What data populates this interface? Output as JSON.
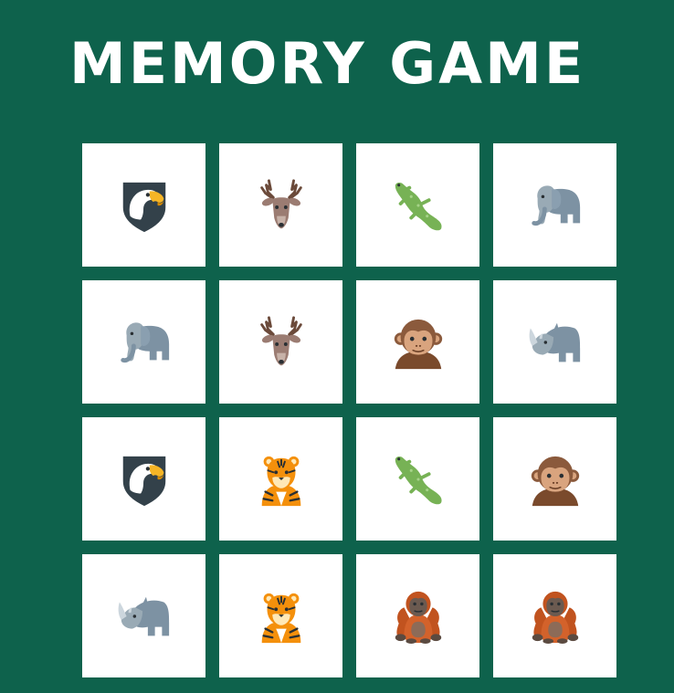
{
  "header": {
    "title": "MEMORY GAME"
  },
  "board": {
    "rows": 4,
    "columns": 4,
    "cards": [
      {
        "animal": "eagle",
        "icon": "eagle-shield-icon"
      },
      {
        "animal": "deer",
        "icon": "deer-icon"
      },
      {
        "animal": "lizard",
        "icon": "lizard-icon"
      },
      {
        "animal": "elephant",
        "icon": "elephant-icon"
      },
      {
        "animal": "elephant",
        "icon": "elephant-icon"
      },
      {
        "animal": "deer",
        "icon": "deer-icon"
      },
      {
        "animal": "monkey",
        "icon": "monkey-face-icon"
      },
      {
        "animal": "rhinoceros",
        "icon": "rhinoceros-icon"
      },
      {
        "animal": "eagle",
        "icon": "eagle-shield-icon"
      },
      {
        "animal": "tiger",
        "icon": "tiger-icon"
      },
      {
        "animal": "lizard",
        "icon": "lizard-icon"
      },
      {
        "animal": "monkey",
        "icon": "monkey-face-icon"
      },
      {
        "animal": "rhinoceros",
        "icon": "rhinoceros-icon"
      },
      {
        "animal": "tiger",
        "icon": "tiger-icon"
      },
      {
        "animal": "orangutan",
        "icon": "orangutan-icon"
      },
      {
        "animal": "orangutan",
        "icon": "orangutan-icon"
      }
    ]
  },
  "colors": {
    "background": "#0e624c",
    "card": "#ffffff",
    "title": "#ffffff"
  }
}
